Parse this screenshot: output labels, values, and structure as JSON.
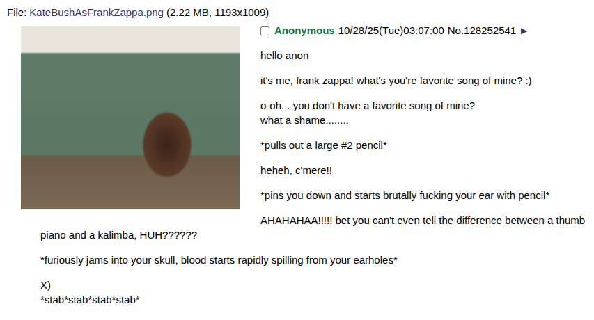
{
  "file": {
    "label": "File:",
    "name": "KateBushAsFrankZappa.png",
    "info": "(2.22 MB, 1193x1009)"
  },
  "post": {
    "checked": false,
    "name": "Anonymous",
    "datetime": "10/28/25(Tue)03:07:00",
    "number": "No.128252541",
    "arrow": "▶"
  },
  "message": [
    [
      "hello anon"
    ],
    [
      "it's me, frank zappa! what's you're favorite song of mine? :)"
    ],
    [
      "o-oh... you don't have a favorite song of mine?",
      "what a shame........"
    ],
    [
      "*pulls out a large #2 pencil*"
    ],
    [
      "heheh, c'mere!!"
    ],
    [
      "*pins you down and starts brutally fucking your ear with pencil*"
    ],
    [
      "AHAHAHAA!!!!! bet you can't even tell the difference between a thumb piano and a kalimba, HUH??????"
    ],
    [
      "*furiously jams into your skull, blood starts rapidly spilling from your earholes*"
    ],
    [
      "X)",
      "*stab*stab*stab*stab*"
    ]
  ]
}
